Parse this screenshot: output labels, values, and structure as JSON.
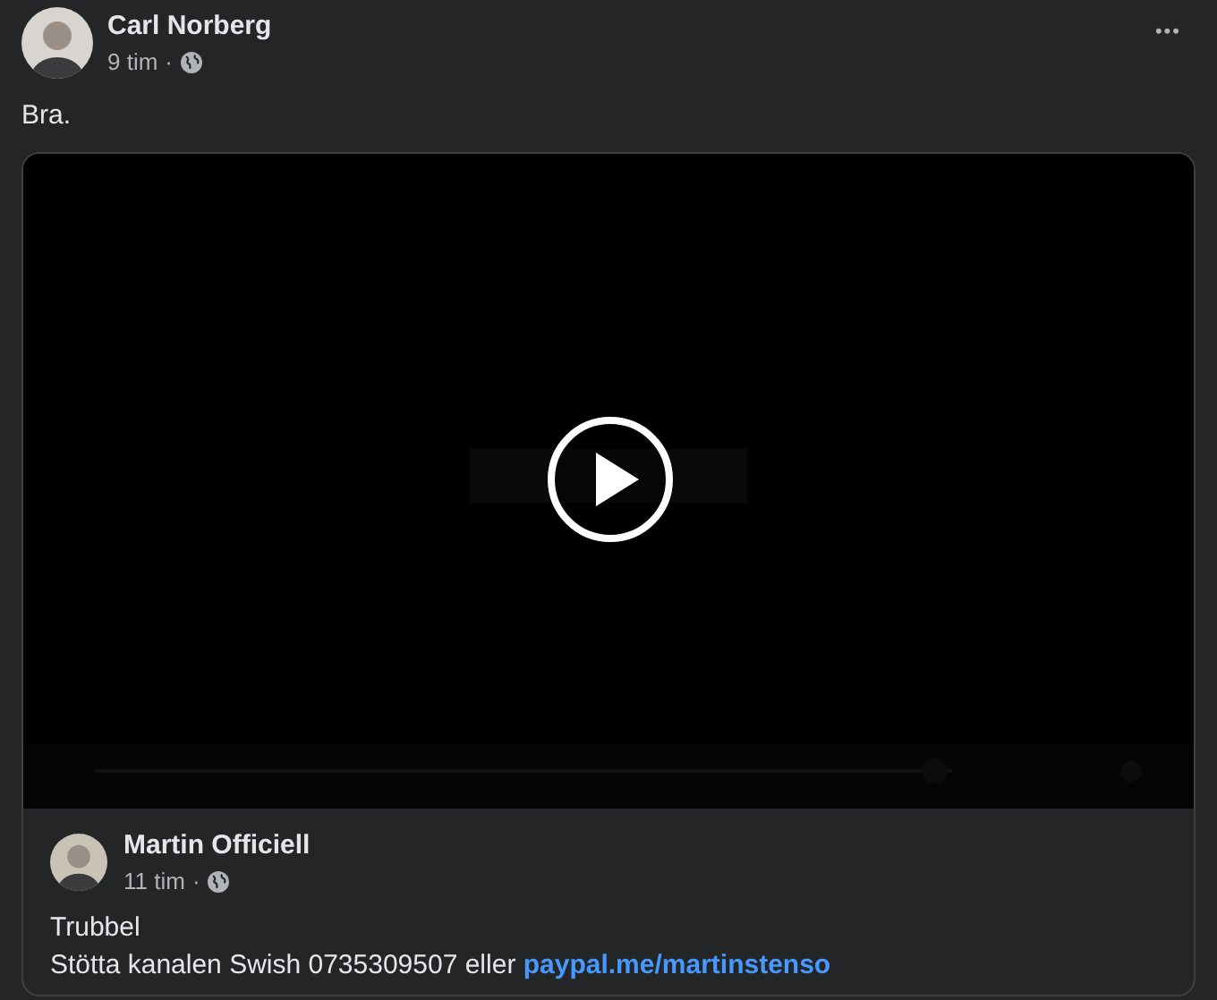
{
  "post": {
    "author": "Carl Norberg",
    "time": "9 tim",
    "separator": "·",
    "text": "Bra.",
    "menu": "•••"
  },
  "shared": {
    "author": "Martin Officiell",
    "time": "11 tim",
    "separator": "·",
    "title": "Trubbel",
    "description": "Stötta kanalen Swish 0735309507 eller",
    "link": "paypal.me/martinstenso"
  }
}
